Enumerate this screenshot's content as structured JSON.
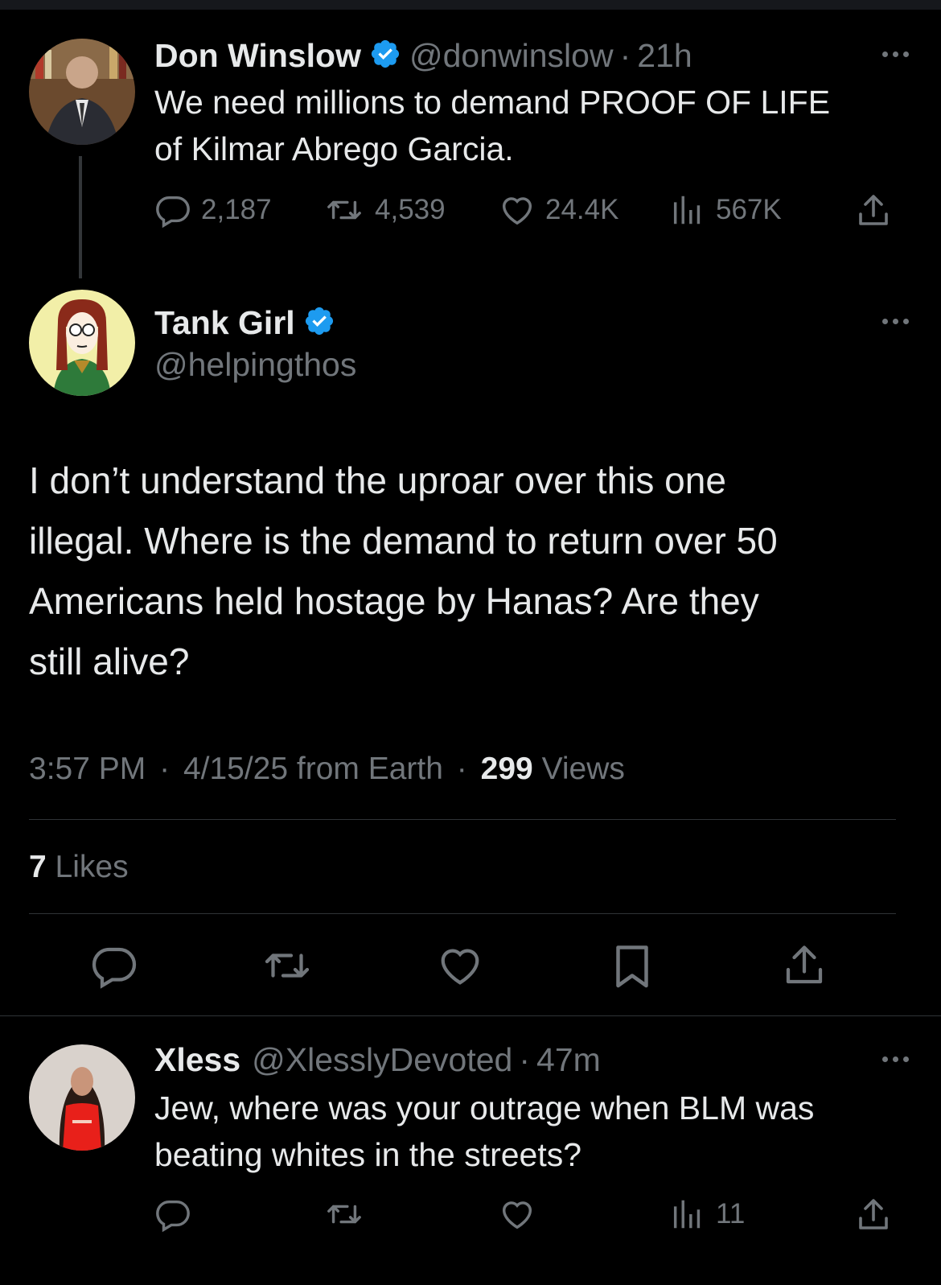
{
  "tweet1": {
    "name": "Don Winslow",
    "handle": "@donwinslow",
    "sep": "·",
    "time": "21h",
    "text_line1": "We need millions to demand PROOF OF LIFE",
    "text_line2": "of Kilmar Abrego Garcia.",
    "replies": "2,187",
    "retweets": "4,539",
    "likes": "24.4K",
    "views": "567K"
  },
  "main_tweet": {
    "name": "Tank Girl",
    "handle": "@helpingthos",
    "line1": "I don’t understand the uproar over this one",
    "line2": "illegal. Where is the demand to return over 50",
    "line3": "Americans held hostage by Hanas?  Are they",
    "line4": "still alive?",
    "time": "3:57 PM",
    "sep": "·",
    "date_from": "4/15/25 from Earth",
    "views_count": "299",
    "views_label": "Views",
    "likes_count": "7",
    "likes_label": "Likes"
  },
  "reply": {
    "name": "Xless",
    "handle": "@XlesslyDevoted",
    "sep": "·",
    "time": "47m",
    "line1": "Jew, where was your outrage when BLM was",
    "line2": "beating whites in the streets?",
    "views": "11"
  },
  "colors": {
    "background": "#000000",
    "text": "#e7e9ea",
    "muted": "#71767b",
    "verified": "#1d9bf0",
    "divider": "#2f3336"
  },
  "icons": [
    "reply-icon",
    "retweet-icon",
    "like-icon",
    "views-icon",
    "share-icon",
    "bookmark-icon",
    "verified-badge-icon",
    "more-icon"
  ]
}
